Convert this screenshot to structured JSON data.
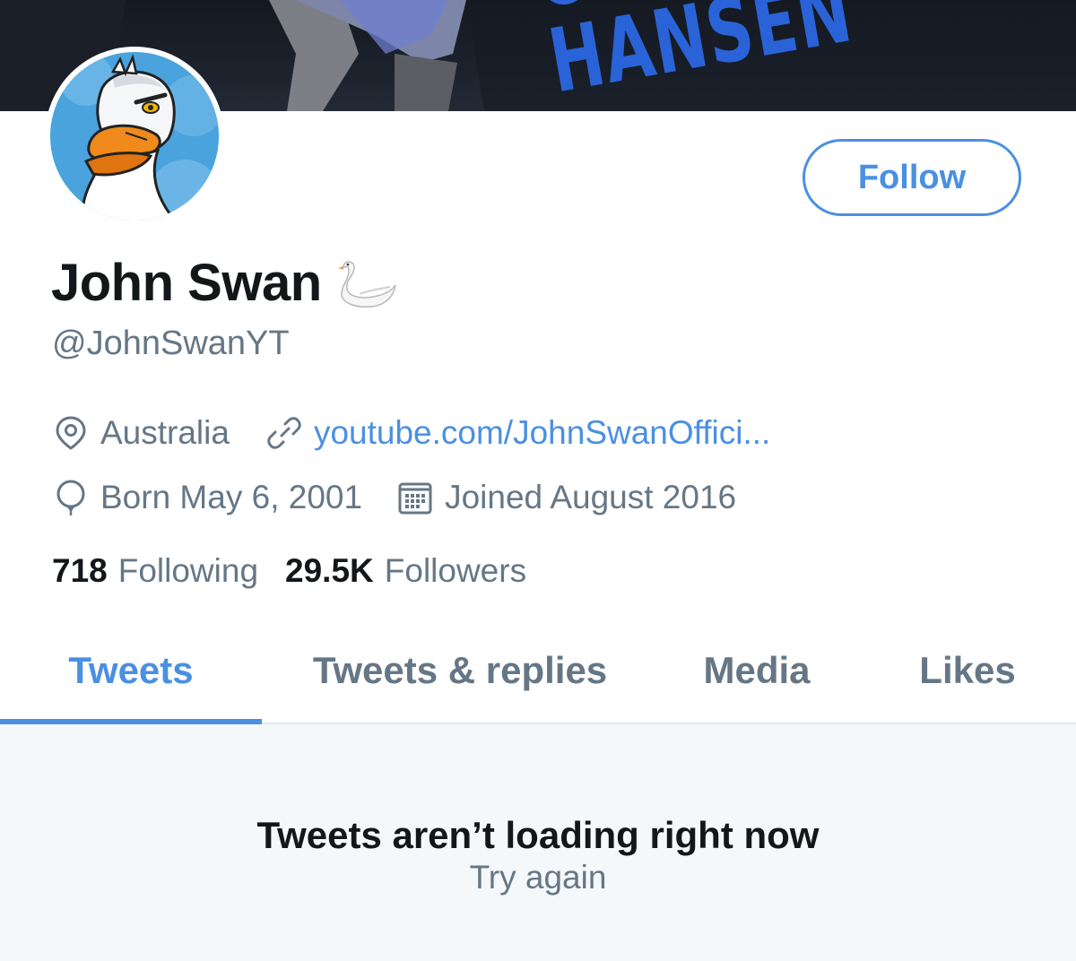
{
  "banner": {
    "text_top": "CHRI",
    "text_main": "HANSEN"
  },
  "profile": {
    "display_name": "John Swan",
    "name_emoji": "swan-emoji",
    "handle": "@JohnSwanYT",
    "follow_label": "Follow",
    "location": "Australia",
    "website": "youtube.com/JohnSwanOffici...",
    "birthday": "Born May 6, 2001",
    "joined": "Joined August 2016"
  },
  "stats": {
    "following_count": "718",
    "following_label": "Following",
    "followers_count": "29.5K",
    "followers_label": "Followers"
  },
  "tabs": [
    {
      "label": "Tweets",
      "active": true
    },
    {
      "label": "Tweets & replies",
      "active": false
    },
    {
      "label": "Media",
      "active": false
    },
    {
      "label": "Likes",
      "active": false
    }
  ],
  "feed": {
    "message": "Tweets aren’t loading right now",
    "retry_label": "Try again"
  },
  "icons": {
    "location": "location-pin-icon",
    "website": "link-icon",
    "birthday": "balloon-icon",
    "joined": "calendar-icon"
  },
  "colors": {
    "accent": "#4a90e2",
    "text_primary": "#14171a",
    "text_secondary": "#657786",
    "feed_background": "#f5f8fa"
  }
}
